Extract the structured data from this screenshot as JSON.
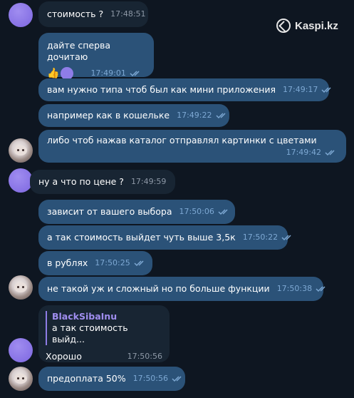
{
  "logo": {
    "text": "Kaspi.kz",
    "icon": "kaspi-logo-icon"
  },
  "messages": [
    {
      "text": "стоимость ?",
      "time": "17:48:51",
      "dir": "in"
    },
    {
      "text": "дайте сперва дочитаю",
      "time": "17:49:01",
      "dir": "out",
      "reactions": [
        "👍"
      ]
    },
    {
      "text": "вам нужно типа чтоб был как мини приложения",
      "time": "17:49:17",
      "dir": "out"
    },
    {
      "text": "например как в кошельке",
      "time": "17:49:22",
      "dir": "out"
    },
    {
      "text": "либо чтоб нажав каталог отправлял картинки с цветами",
      "time": "17:49:42",
      "dir": "out"
    },
    {
      "text": "ну а что по цене ?",
      "time": "17:49:59",
      "dir": "in"
    },
    {
      "text": "зависит от вашего выбора",
      "time": "17:50:06",
      "dir": "out"
    },
    {
      "text": "а так стоимость выйдет чуть выше 3,5к",
      "time": "17:50:22",
      "dir": "out"
    },
    {
      "text": "в рублях",
      "time": "17:50:25",
      "dir": "out"
    },
    {
      "text": "не такой уж и сложный но по больше функции",
      "time": "17:50:38",
      "dir": "out"
    },
    {
      "reply_author": "BlackSibaInu",
      "reply_text": "а так стоимость выйд...",
      "text": "Хорошо",
      "time": "17:50:56",
      "dir": "in"
    },
    {
      "text": "предоплата 50%",
      "time": "17:50:56",
      "dir": "out"
    }
  ],
  "colors": {
    "background": "#0e1621",
    "incoming": "#182533",
    "outgoing": "#2b5278",
    "accent": "#8e7ce6"
  }
}
